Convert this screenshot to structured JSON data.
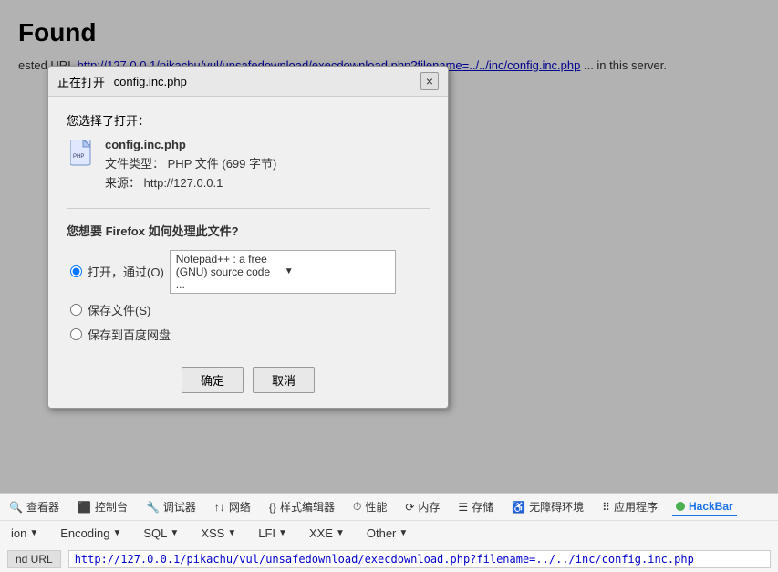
{
  "page": {
    "title": "Found",
    "description": "ested URL ... in this server."
  },
  "dialog": {
    "titlebar": {
      "prefix": "正在打开",
      "filename": "config.inc.php",
      "close_label": "×"
    },
    "body": {
      "section_label": "您选择了打开：",
      "file": {
        "name": "config.inc.php",
        "type_label": "文件类型：",
        "type_value": "PHP 文件 (699 字节)",
        "source_label": "来源：",
        "source_value": "http://127.0.0.1"
      },
      "question": "您想要 Firefox 如何处理此文件?",
      "options": [
        {
          "id": "opt-open",
          "label": "打开，通过(O)",
          "checked": true
        },
        {
          "id": "opt-save",
          "label": "保存文件(S)",
          "checked": false
        },
        {
          "id": "opt-save-baidu",
          "label": "保存到百度网盘",
          "checked": false
        }
      ],
      "app_dropdown": "Notepad++ : a free (GNU) source code ..."
    },
    "footer": {
      "confirm_btn": "确定",
      "cancel_btn": "取消"
    }
  },
  "devtools": {
    "icons": [
      {
        "name": "inspector",
        "label": "查看器",
        "icon": "🔍"
      },
      {
        "name": "console",
        "label": "控制台",
        "icon": "⬛"
      },
      {
        "name": "debugger",
        "label": "调试器",
        "icon": "🐛"
      },
      {
        "name": "network",
        "label": "网络",
        "icon": "↑↓"
      },
      {
        "name": "style-editor",
        "label": "样式编辑器",
        "icon": "{}"
      },
      {
        "name": "performance",
        "label": "性能",
        "icon": "⏱"
      },
      {
        "name": "memory",
        "label": "内存",
        "icon": "⟳"
      },
      {
        "name": "storage",
        "label": "存储",
        "icon": "☰"
      },
      {
        "name": "accessibility",
        "label": "无障碍环境",
        "icon": "♿"
      },
      {
        "name": "apps",
        "label": "应用程序",
        "icon": "⠿"
      },
      {
        "name": "hackbar",
        "label": "HackBar",
        "active": true
      }
    ],
    "menu": [
      {
        "name": "load",
        "label": "ion"
      },
      {
        "name": "encoding",
        "label": "Encoding"
      },
      {
        "name": "sql",
        "label": "SQL"
      },
      {
        "name": "xss",
        "label": "XSS"
      },
      {
        "name": "lfi",
        "label": "LFI"
      },
      {
        "name": "xxe",
        "label": "XXE"
      },
      {
        "name": "other",
        "label": "Other"
      }
    ],
    "url_bar": {
      "label": "nd URL",
      "value": "http://127.0.0.1/pikachu/vul/unsafedownload/execdownload.php?filename=../../inc/config.inc.php"
    }
  }
}
